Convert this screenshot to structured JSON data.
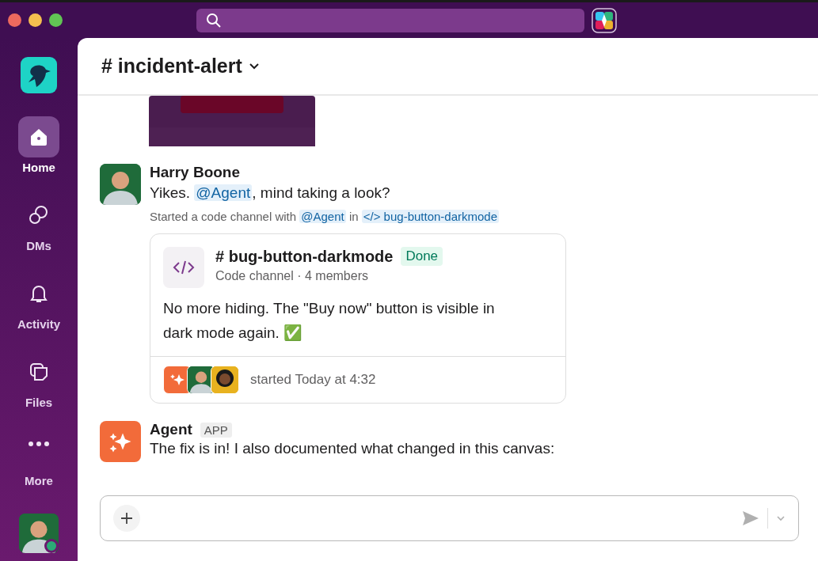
{
  "sidebar": {
    "items": [
      {
        "kind": "home",
        "label": "Home",
        "selected": true
      },
      {
        "kind": "dms",
        "label": "DMs",
        "selected": false
      },
      {
        "kind": "activity",
        "label": "Activity",
        "selected": false
      },
      {
        "kind": "files",
        "label": "Files",
        "selected": false
      },
      {
        "kind": "more",
        "label": "More",
        "selected": false
      }
    ],
    "user": {
      "online": true
    }
  },
  "channel": {
    "prefix": "#",
    "name": "incident-alert"
  },
  "messages": [
    {
      "kind": "picture"
    },
    {
      "kind": "user",
      "author": "Harry Boone",
      "text": [
        {
          "text": "Yikes. "
        },
        {
          "text": "@Agent",
          "mention": true
        },
        {
          "text": ", mind taking a look?"
        }
      ],
      "meta": [
        {
          "text": "Started a code channel with "
        },
        {
          "text": "@Agent",
          "mention": true
        },
        {
          "text": " in "
        },
        {
          "text": "</> bug-button-darkmode",
          "mention": true
        }
      ],
      "card": {
        "prefix": "#",
        "title": "bug-button-darkmode",
        "status": "Done",
        "subtitle": "Code channel · 4 members",
        "body": "No more hiding. The \"Buy now\" button is visible in dark mode again. ✅",
        "footer": "started Today at 4:32"
      }
    },
    {
      "kind": "app",
      "author": "Agent",
      "badge": "APP",
      "text": [
        {
          "text": "The fix is in! I also documented what changed in this canvas:"
        }
      ]
    }
  ]
}
